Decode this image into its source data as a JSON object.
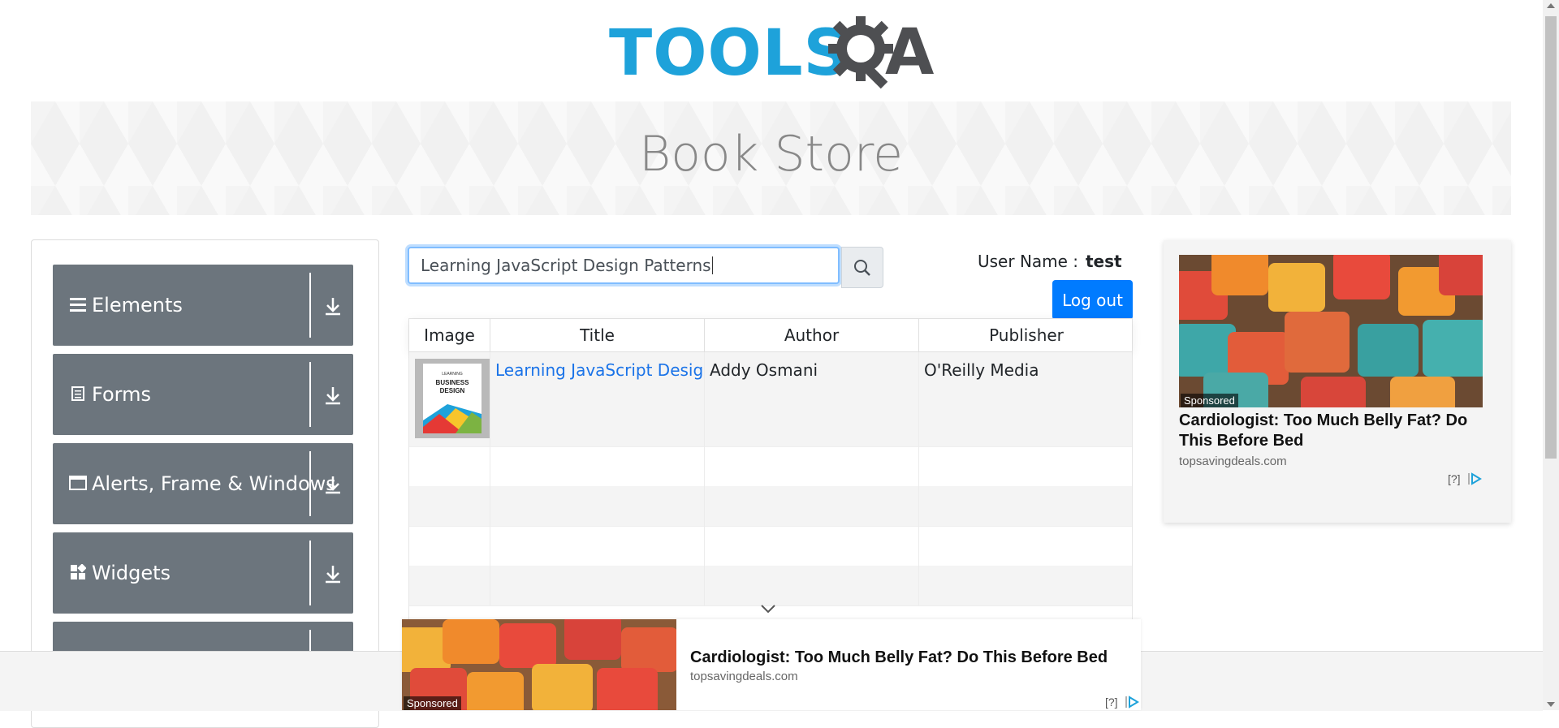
{
  "header": {
    "logo_tools": "TOOLS",
    "logo_qa_a": "A",
    "page_title": "Book Store"
  },
  "sidebar": {
    "items": [
      {
        "label": "Elements",
        "icon": "hamburger-icon"
      },
      {
        "label": "Forms",
        "icon": "document-icon"
      },
      {
        "label": "Alerts, Frame & Windows",
        "icon": "window-icon"
      },
      {
        "label": "Widgets",
        "icon": "widgets-icon"
      },
      {
        "label": "",
        "icon": ""
      }
    ]
  },
  "search": {
    "value": "Learning JavaScript Design Patterns",
    "button_icon": "search-icon"
  },
  "user": {
    "label": "User Name :",
    "name": "test",
    "logout_label": "Log out"
  },
  "table": {
    "columns": [
      "Image",
      "Title",
      "Author",
      "Publisher"
    ],
    "rows": [
      {
        "image": "book-cover",
        "cover_small": "LEARNING",
        "cover_title_1": "BUSINESS",
        "cover_title_2": "DESIGN",
        "title": "Learning JavaScript Design Patterns",
        "author": "Addy Osmani",
        "publisher": "O'Reilly Media"
      }
    ]
  },
  "ads": {
    "right": {
      "tag": "Sponsored",
      "title": "Cardiologist: Too Much Belly Fat? Do This Before Bed",
      "site": "topsavingdeals.com",
      "help": "[?]"
    },
    "bottom": {
      "tag": "Sponsored",
      "title": "Cardiologist: Too Much Belly Fat? Do This Before Bed",
      "site": "topsavingdeals.com",
      "help": "[?]"
    }
  },
  "colors": {
    "brand_blue": "#1ea2da",
    "brand_gray": "#4e4f52",
    "menu_bg": "#6c757d",
    "primary": "#007bff",
    "link": "#1a73e8"
  }
}
